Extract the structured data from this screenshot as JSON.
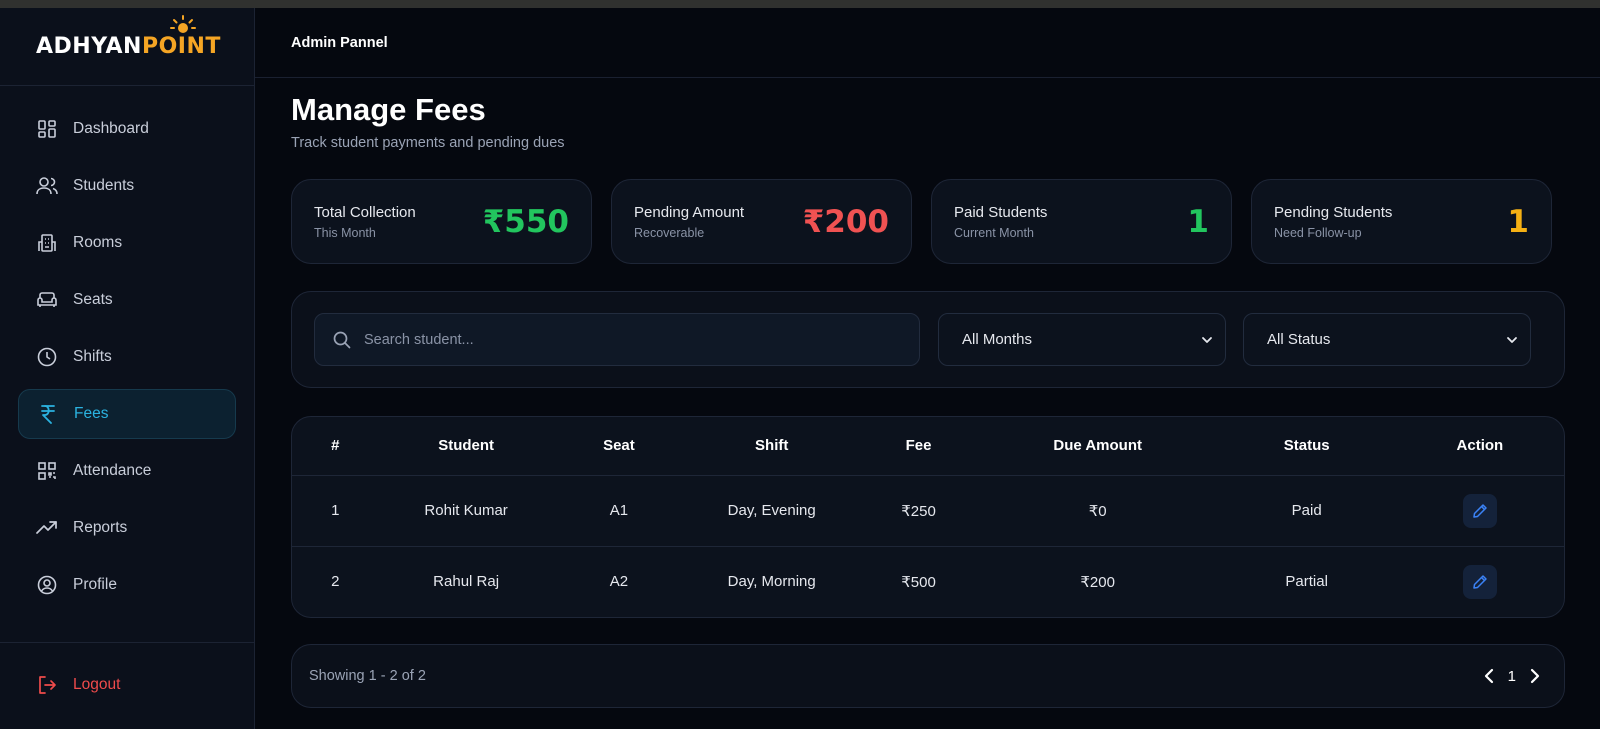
{
  "brand": {
    "logo_a": "A",
    "logo_word1": "DHYAN",
    "logo_word2": "POINT",
    "accent": "#f5a524"
  },
  "sidebar": {
    "items": [
      {
        "label": "Dashboard",
        "icon": "dashboard-icon",
        "active": false
      },
      {
        "label": "Students",
        "icon": "users-icon",
        "active": false
      },
      {
        "label": "Rooms",
        "icon": "building-icon",
        "active": false
      },
      {
        "label": "Seats",
        "icon": "sofa-icon",
        "active": false
      },
      {
        "label": "Shifts",
        "icon": "clock-icon",
        "active": false
      },
      {
        "label": "Fees",
        "icon": "rupee-icon",
        "active": true
      },
      {
        "label": "Attendance",
        "icon": "qr-code-icon",
        "active": false
      },
      {
        "label": "Reports",
        "icon": "trending-up-icon",
        "active": false
      },
      {
        "label": "Profile",
        "icon": "user-circle-icon",
        "active": false
      }
    ],
    "logout_label": "Logout"
  },
  "header": {
    "title": "Admin Pannel"
  },
  "page": {
    "title": "Manage Fees",
    "subtitle": "Track student payments and pending dues"
  },
  "stats": [
    {
      "label": "Total Collection",
      "sub": "This Month",
      "value": "₹550",
      "color": "#22c55e"
    },
    {
      "label": "Pending Amount",
      "sub": "Recoverable",
      "value": "₹200",
      "color": "#f05252"
    },
    {
      "label": "Paid Students",
      "sub": "Current Month",
      "value": "1",
      "color": "#22c55e"
    },
    {
      "label": "Pending Students",
      "sub": "Need Follow-up",
      "value": "1",
      "color": "#f5b014"
    }
  ],
  "filters": {
    "search_placeholder": "Search student...",
    "search_value": "",
    "month_selected": "All Months",
    "status_selected": "All Status"
  },
  "table": {
    "columns": [
      "#",
      "Student",
      "Seat",
      "Shift",
      "Fee",
      "Due Amount",
      "Status",
      "Action"
    ],
    "rows": [
      {
        "num": "1",
        "student": "Rohit Kumar",
        "seat": "A1",
        "shift": "Day, Evening",
        "fee": "₹250",
        "due": "₹0",
        "status": "Paid"
      },
      {
        "num": "2",
        "student": "Rahul Raj",
        "seat": "A2",
        "shift": "Day, Morning",
        "fee": "₹500",
        "due": "₹200",
        "status": "Partial"
      }
    ]
  },
  "pagination": {
    "info": "Showing 1 - 2 of 2",
    "page": "1"
  }
}
